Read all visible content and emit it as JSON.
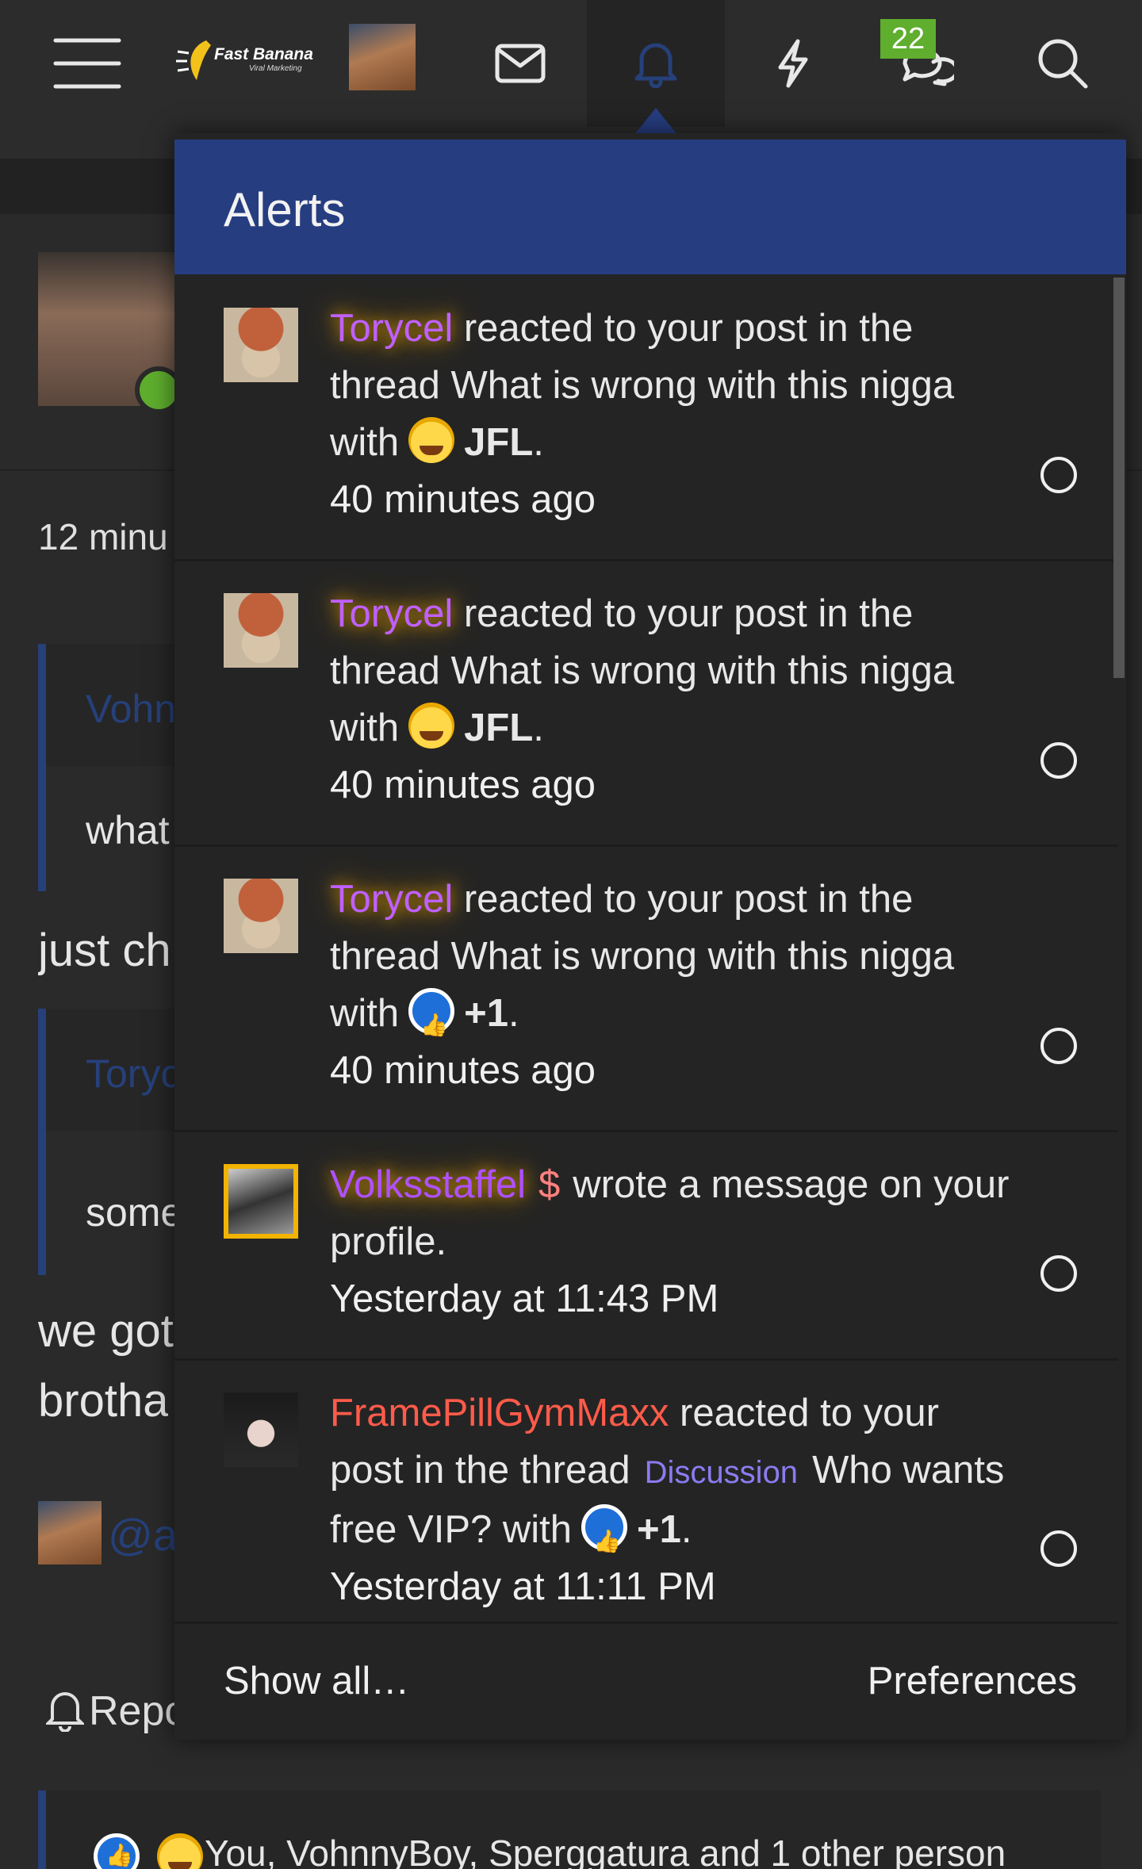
{
  "nav": {
    "brand": "Fast Banana",
    "brand_tagline": "Viral Marketing",
    "conversations_badge": "22",
    "icons": [
      "menu-icon",
      "mail-icon",
      "bell-icon",
      "lightning-icon",
      "chat-icon",
      "search-icon"
    ]
  },
  "background_page": {
    "time_partial": "12 minu",
    "quote1_author": "Vohn",
    "quote1_text": "what",
    "line1": "just ch",
    "quote2_author": "Toryc",
    "quote2_text": "some",
    "line2a": "we got",
    "line2b": "brotha",
    "mention_partial": "@a",
    "report_partial": "Repo",
    "reactions_summary": "You, VohnnyBoy, Sperggatura and 1 other person"
  },
  "alerts": {
    "title": "Alerts",
    "items": [
      {
        "user": "Torycel",
        "action": "reacted to your post in the thread What is wrong with this nigga with",
        "reaction": "JFL",
        "reaction_icon": "jfl-emoji-icon",
        "time": "40 minutes ago"
      },
      {
        "user": "Torycel",
        "action": "reacted to your post in the thread What is wrong with this nigga with",
        "reaction": "JFL",
        "reaction_icon": "jfl-emoji-icon",
        "time": "40 minutes ago"
      },
      {
        "user": "Torycel",
        "action": "reacted to your post in the thread What is wrong with this nigga with",
        "reaction": "+1",
        "reaction_icon": "thumbs-up-icon",
        "time": "40 minutes ago"
      },
      {
        "user": "Volksstaffel",
        "user_symbol": "$",
        "action": "wrote a message on your profile.",
        "time": "Yesterday at 11:43 PM"
      },
      {
        "user": "FramePillGymMaxx",
        "action_a": "reacted to your post in the thread",
        "prefix": "Discussion",
        "thread": "Who wants free VIP? with",
        "reaction": "+1",
        "reaction_icon": "thumbs-up-icon",
        "time": "Yesterday at 11:11 PM"
      }
    ],
    "show_all": "Show all…",
    "preferences": "Preferences"
  },
  "colors": {
    "header_blue": "#263d80",
    "badge_green": "#5fae2e",
    "torycel_name": "#c060ff",
    "framepill_name": "#ff5b4a",
    "prefix_purple": "#8a7cf0"
  }
}
